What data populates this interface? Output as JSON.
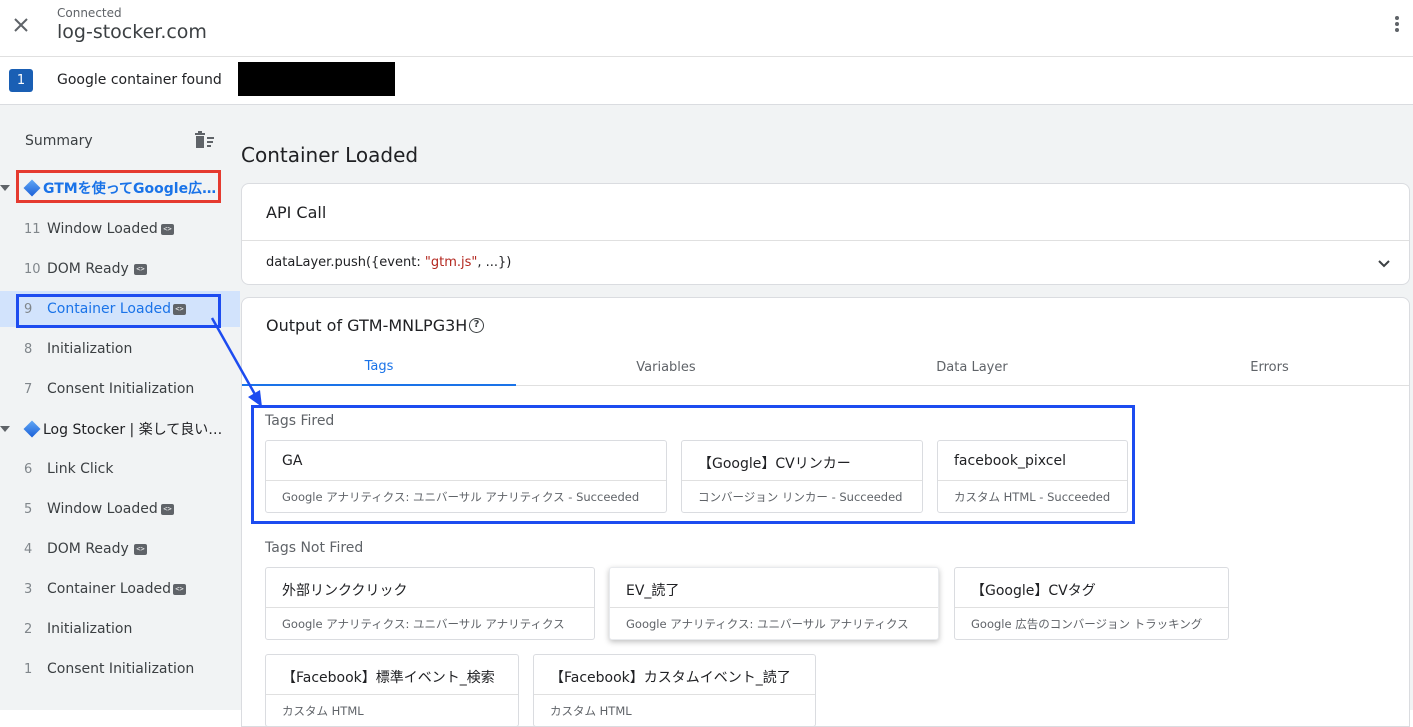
{
  "header": {
    "status": "Connected",
    "domain": "log-stocker.com"
  },
  "container_bar": {
    "count": "1",
    "label": "Google container found"
  },
  "sidebar": {
    "title": "Summary",
    "groups": [
      {
        "label": "GTMを使ってGoogle広…"
      },
      {
        "label": "Log Stocker | 楽して良い…"
      }
    ],
    "events_group1": [
      {
        "num": "11",
        "label": "Window Loaded"
      },
      {
        "num": "10",
        "label": "DOM Ready"
      },
      {
        "num": "9",
        "label": "Container Loaded"
      },
      {
        "num": "8",
        "label": "Initialization"
      },
      {
        "num": "7",
        "label": "Consent Initialization"
      }
    ],
    "events_group2": [
      {
        "num": "6",
        "label": "Link Click"
      },
      {
        "num": "5",
        "label": "Window Loaded"
      },
      {
        "num": "4",
        "label": "DOM Ready"
      },
      {
        "num": "3",
        "label": "Container Loaded"
      },
      {
        "num": "2",
        "label": "Initialization"
      },
      {
        "num": "1",
        "label": "Consent Initialization"
      }
    ]
  },
  "main": {
    "title": "Container Loaded",
    "api_call": {
      "title": "API Call",
      "code_prefix": "dataLayer.push({event: ",
      "code_string": "\"gtm.js\"",
      "code_suffix": ", ...})"
    },
    "output": {
      "title": "Output of GTM-MNLPG3H",
      "help": "?",
      "tabs": [
        "Tags",
        "Variables",
        "Data Layer",
        "Errors"
      ],
      "active_tab": "Tags",
      "fired_label": "Tags Fired",
      "not_fired_label": "Tags Not Fired",
      "tags_fired": [
        {
          "name": "GA",
          "sub": "Google アナリティクス: ユニバーサル アナリティクス - Succeeded"
        },
        {
          "name": "【Google】CVリンカー",
          "sub": "コンバージョン リンカー - Succeeded"
        },
        {
          "name": "facebook_pixcel",
          "sub": "カスタム HTML - Succeeded"
        }
      ],
      "tags_not_fired": [
        {
          "name": "外部リンククリック",
          "sub": "Google アナリティクス: ユニバーサル アナリティクス"
        },
        {
          "name": "EV_読了",
          "sub": "Google アナリティクス: ユニバーサル アナリティクス"
        },
        {
          "name": "【Google】CVタグ",
          "sub": "Google 広告のコンバージョン トラッキング"
        },
        {
          "name": "【Facebook】標準イベント_検索",
          "sub": "カスタム HTML"
        },
        {
          "name": "【Facebook】カスタムイベント_読了",
          "sub": "カスタム HTML"
        }
      ]
    }
  },
  "colors": {
    "accent": "#1a73e8",
    "highlight_red": "#e53a2f",
    "highlight_blue": "#1d4cf0",
    "badge": "#1a5fb4"
  }
}
